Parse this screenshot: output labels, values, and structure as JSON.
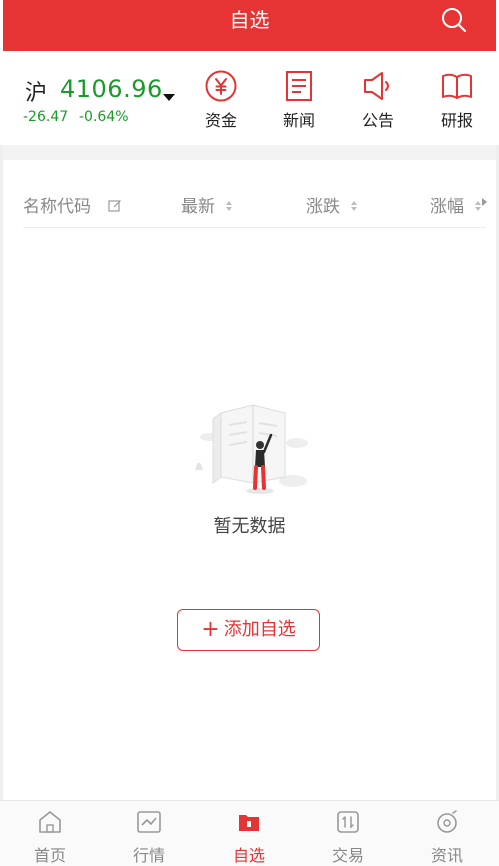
{
  "header": {
    "title": "自选"
  },
  "index": {
    "name": "沪",
    "value": "4106.96",
    "change": "-26.47",
    "change_pct": "-0.64%"
  },
  "shortcuts": [
    {
      "label": "资金",
      "icon": "yuan-circle-icon"
    },
    {
      "label": "新闻",
      "icon": "document-icon"
    },
    {
      "label": "公告",
      "icon": "speaker-icon"
    },
    {
      "label": "研报",
      "icon": "book-icon"
    }
  ],
  "columns": {
    "name": "名称代码",
    "latest": "最新",
    "change": "涨跌",
    "change_pct": "涨幅"
  },
  "empty_state": {
    "message": "暂无数据",
    "add_button": "添加自选"
  },
  "tabs": [
    {
      "label": "首页",
      "icon": "home-icon"
    },
    {
      "label": "行情",
      "icon": "chart-icon"
    },
    {
      "label": "自选",
      "icon": "watchlist-icon",
      "active": true
    },
    {
      "label": "交易",
      "icon": "trade-icon"
    },
    {
      "label": "资讯",
      "icon": "news-icon"
    }
  ],
  "colors": {
    "brand_red": "#e63333",
    "fall_green": "#1a9a2a"
  }
}
